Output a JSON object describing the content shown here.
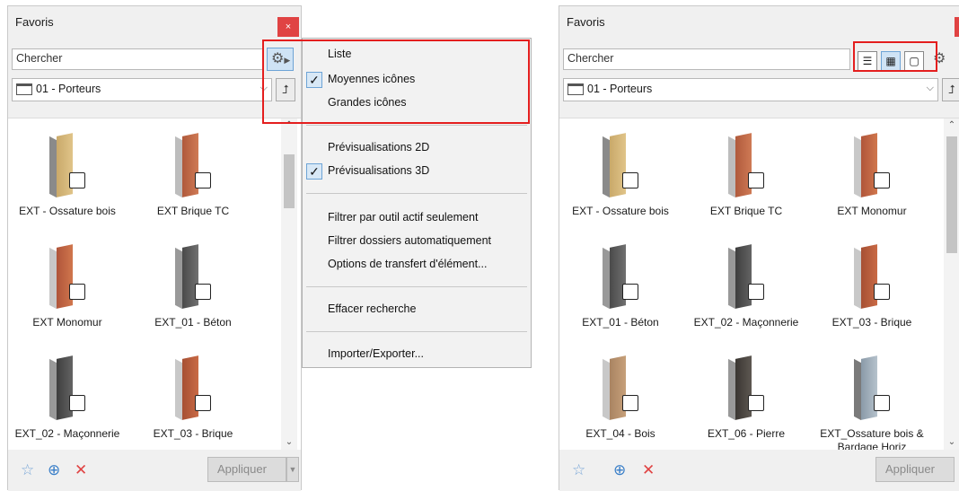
{
  "left_panel": {
    "title": "Favoris",
    "close_label": "×",
    "search_placeholder": "Chercher",
    "folder": "01 - Porteurs",
    "items": [
      {
        "label": "EXT - Ossature bois"
      },
      {
        "label": "EXT Brique TC"
      },
      {
        "label": "EXT Monomur"
      },
      {
        "label": "EXT_01 - Béton"
      },
      {
        "label": "EXT_02 - Maçonnerie"
      },
      {
        "label": "EXT_03 - Brique"
      }
    ],
    "apply_label": "Appliquer"
  },
  "menu": {
    "items": [
      {
        "label": "Liste",
        "checked": false
      },
      {
        "label": "Moyennes icônes",
        "checked": true
      },
      {
        "label": "Grandes icônes",
        "checked": false
      },
      {
        "label": "Prévisualisations 2D",
        "checked": false
      },
      {
        "label": "Prévisualisations 3D",
        "checked": true
      },
      {
        "label": "Filtrer par outil actif seulement",
        "checked": false
      },
      {
        "label": "Filtrer dossiers automatiquement",
        "checked": false
      },
      {
        "label": "Options de transfert d'élément...",
        "checked": false
      },
      {
        "label": "Effacer recherche",
        "checked": false
      },
      {
        "label": "Importer/Exporter...",
        "checked": false
      }
    ],
    "check_glyph": "✓"
  },
  "right_panel": {
    "title": "Favoris",
    "search_placeholder": "Chercher",
    "folder": "01 - Porteurs",
    "items": [
      {
        "label": "EXT - Ossature bois"
      },
      {
        "label": "EXT Brique TC"
      },
      {
        "label": "EXT Monomur"
      },
      {
        "label": "EXT_01 - Béton"
      },
      {
        "label": "EXT_02 - Maçonnerie"
      },
      {
        "label": "EXT_03 - Brique"
      },
      {
        "label": "EXT_04 - Bois"
      },
      {
        "label": "EXT_06 - Pierre"
      },
      {
        "label": "EXT_Ossature bois & Bardage Horiz"
      }
    ],
    "apply_label": "Appliquer"
  },
  "colors": {
    "highlight": "#e41e1e",
    "delete_icon": "#e04343",
    "add_icon": "#3a7fc8"
  }
}
